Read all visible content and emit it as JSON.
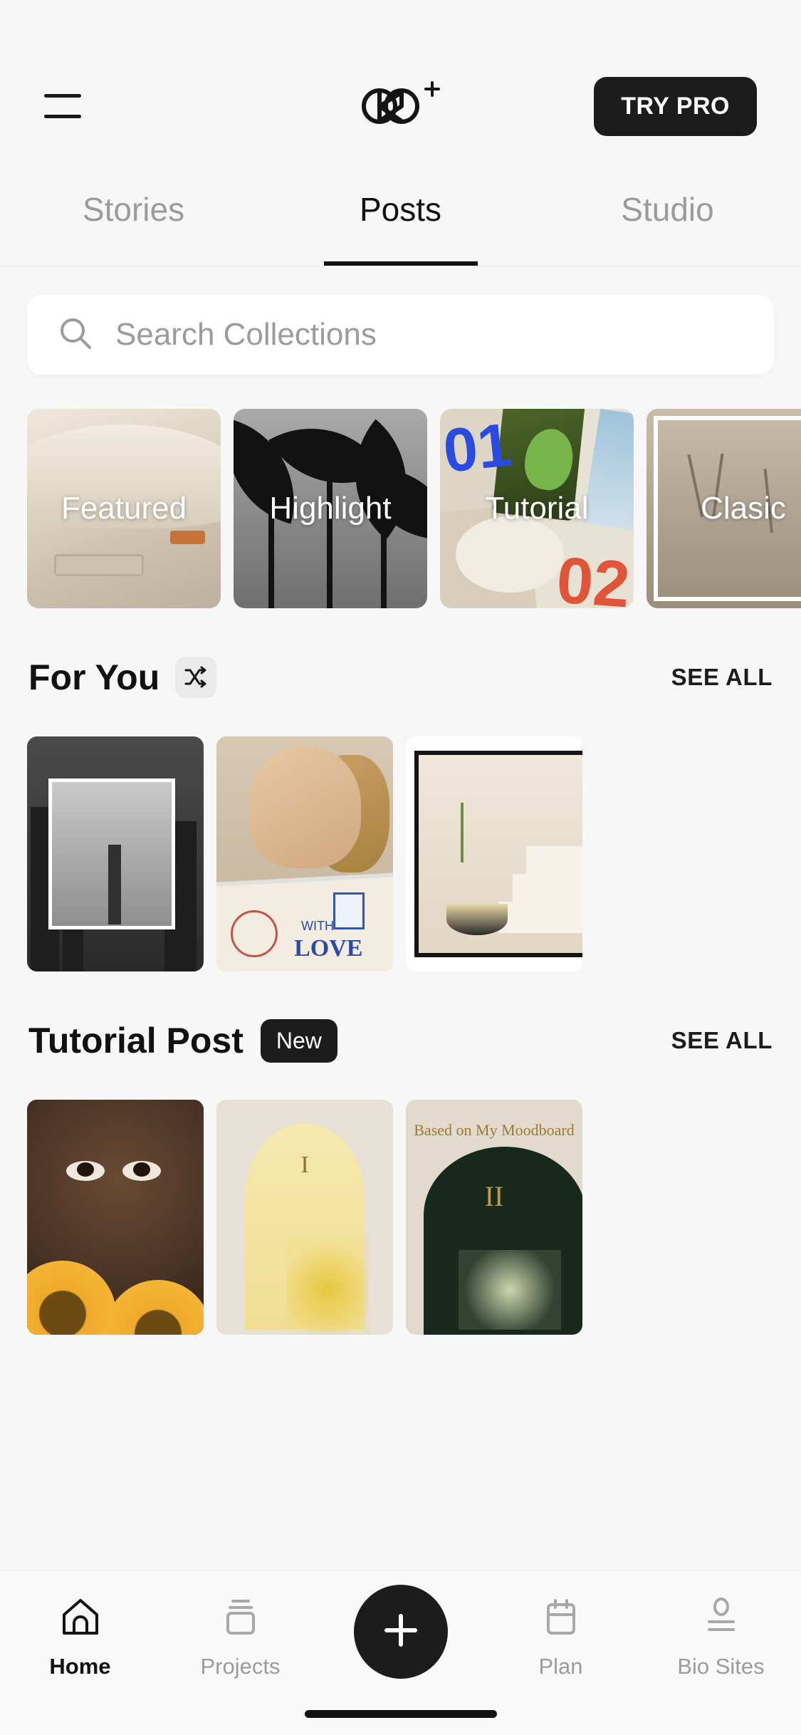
{
  "header": {
    "menu_icon": "hamburger-icon",
    "logo_icon": "brand-infinity-plus-logo",
    "try_pro_label": "TRY PRO"
  },
  "tabs": [
    {
      "label": "Stories",
      "active": false
    },
    {
      "label": "Posts",
      "active": true
    },
    {
      "label": "Studio",
      "active": false
    }
  ],
  "search": {
    "icon": "search-icon",
    "placeholder": "Search Collections",
    "value": ""
  },
  "collections": [
    {
      "label": "Featured"
    },
    {
      "label": "Highlight"
    },
    {
      "label": "Tutorial"
    },
    {
      "label": "Clasic"
    }
  ],
  "sections": [
    {
      "title": "For You",
      "shuffle_icon": "shuffle-icon",
      "badge": "",
      "see_all_label": "SEE ALL"
    },
    {
      "title": "Tutorial Post",
      "badge": "New",
      "see_all_label": "SEE ALL"
    }
  ],
  "for_you_posts": [
    {
      "caption": ""
    },
    {
      "caption": "WITH LOVE"
    },
    {
      "caption": ""
    }
  ],
  "tutorial_posts": [
    {
      "caption": ""
    },
    {
      "caption": "I"
    },
    {
      "caption": "Based on My Moodboard",
      "numeral": "II"
    }
  ],
  "bottom_nav": [
    {
      "label": "Home",
      "icon": "home-icon",
      "active": true
    },
    {
      "label": "Projects",
      "icon": "projects-icon",
      "active": false
    },
    {
      "label": "",
      "icon": "plus-icon",
      "active": false
    },
    {
      "label": "Plan",
      "icon": "calendar-icon",
      "active": false
    },
    {
      "label": "Bio Sites",
      "icon": "bio-sites-icon",
      "active": false
    }
  ],
  "colors": {
    "background": "#f7f7f7",
    "accent_dark": "#1c1c1c",
    "muted_text": "#9b9b9b",
    "card_surface": "#ffffff"
  }
}
